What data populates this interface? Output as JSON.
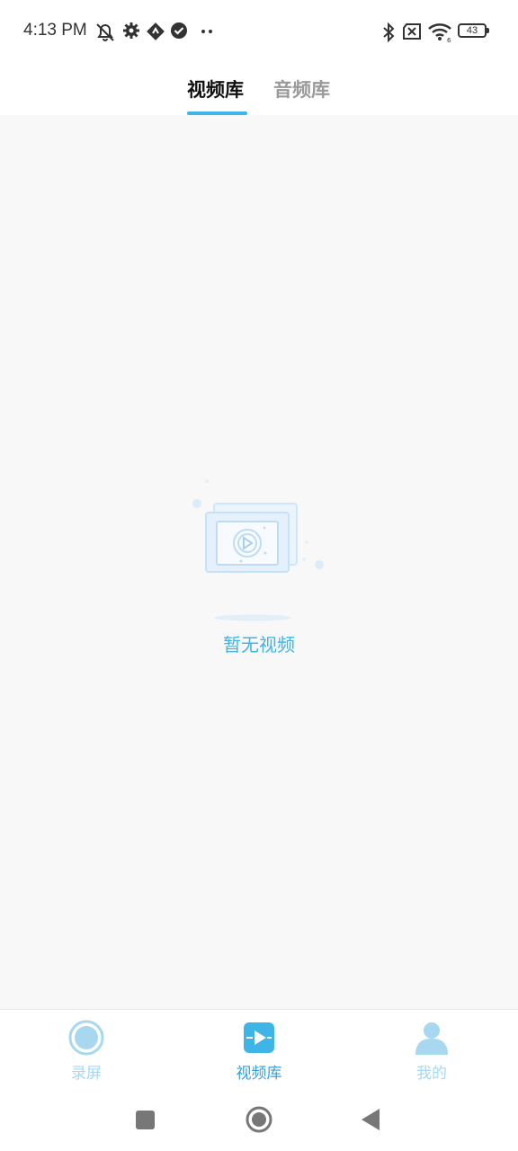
{
  "status_bar": {
    "time": "4:13 PM",
    "battery_level": "43",
    "icons": [
      "mute-notifications-icon",
      "settings-icon",
      "app-notification-icon",
      "check-circle-icon",
      "more-dots-icon",
      "bluetooth-icon",
      "no-sim-icon",
      "wifi-icon",
      "battery-icon"
    ]
  },
  "top_tabs": {
    "video_tab": "视频库",
    "audio_tab": "音频库",
    "active": "video_tab"
  },
  "empty_state": {
    "message": "暂无视频",
    "icon": "empty-video-illustration"
  },
  "bottom_nav": {
    "items": [
      {
        "label": "录屏",
        "icon": "record-icon",
        "active": false
      },
      {
        "label": "视频库",
        "icon": "video-library-icon",
        "active": true
      },
      {
        "label": "我的",
        "icon": "profile-icon",
        "active": false
      }
    ]
  },
  "system_nav": {
    "icons": [
      "recent-apps-icon",
      "home-icon",
      "back-icon"
    ]
  },
  "colors": {
    "accent": "#3fb4e6",
    "inactive_nav": "#a7d8ef",
    "background": "#f8f8f8"
  }
}
